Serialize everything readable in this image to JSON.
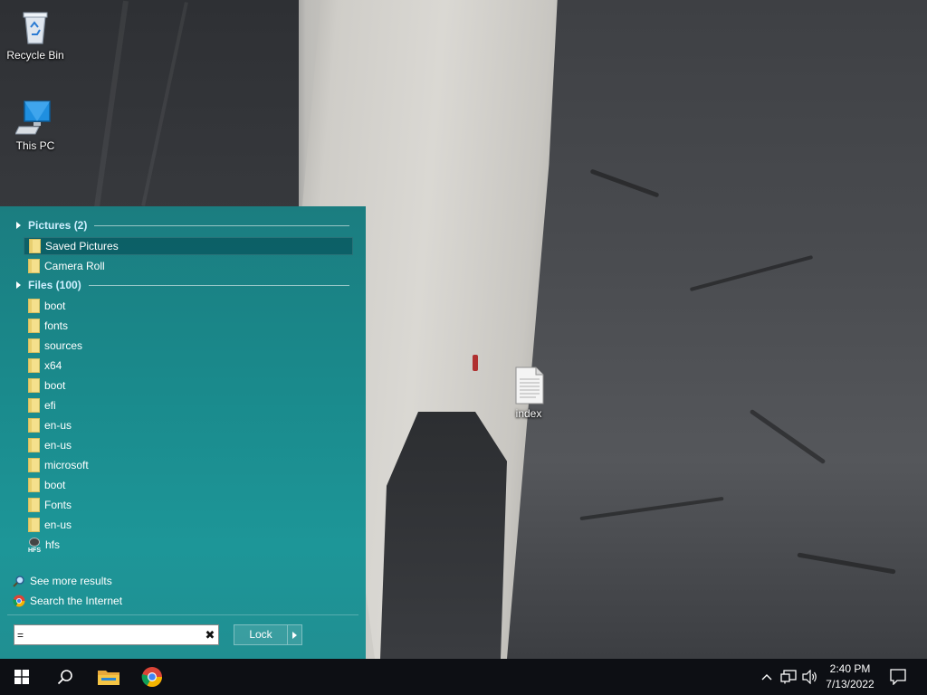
{
  "desktop": {
    "icons": [
      {
        "label": "Recycle Bin",
        "icon": "recycle-bin-icon"
      },
      {
        "label": "This PC",
        "icon": "computer-icon"
      },
      {
        "label": "index",
        "icon": "text-document-icon"
      }
    ]
  },
  "search_panel": {
    "groups": [
      {
        "label": "Pictures (2)"
      },
      {
        "label": "Files (100)"
      }
    ],
    "pictures": [
      {
        "label": "Saved Pictures",
        "icon": "folder-icon",
        "selected": true
      },
      {
        "label": "Camera Roll",
        "icon": "folder-icon"
      }
    ],
    "files": [
      {
        "label": "boot",
        "icon": "folder-icon"
      },
      {
        "label": "fonts",
        "icon": "folder-icon"
      },
      {
        "label": "sources",
        "icon": "folder-icon"
      },
      {
        "label": "x64",
        "icon": "folder-icon"
      },
      {
        "label": "boot",
        "icon": "folder-icon"
      },
      {
        "label": "efi",
        "icon": "folder-icon"
      },
      {
        "label": "en-us",
        "icon": "folder-icon"
      },
      {
        "label": "en-us",
        "icon": "folder-icon"
      },
      {
        "label": "microsoft",
        "icon": "folder-icon"
      },
      {
        "label": "boot",
        "icon": "folder-icon"
      },
      {
        "label": "Fonts",
        "icon": "folder-icon"
      },
      {
        "label": "en-us",
        "icon": "folder-icon"
      },
      {
        "label": "hfs",
        "icon": "hfs-drive-icon"
      }
    ],
    "see_more": "See more results",
    "search_internet": "Search the Internet",
    "search_value": "=",
    "lock_label": "Lock"
  },
  "taskbar": {
    "buttons": [
      "start-button",
      "search-button",
      "file-explorer-button",
      "chrome-button"
    ],
    "tray_icons": [
      "chevron-up-icon",
      "network-icon",
      "volume-icon"
    ],
    "time": "2:40 PM",
    "date": "7/13/2022"
  },
  "colors": {
    "panel": "#1a8a8c",
    "taskbar": "#0d0f14",
    "folder": "#f5e08c"
  }
}
